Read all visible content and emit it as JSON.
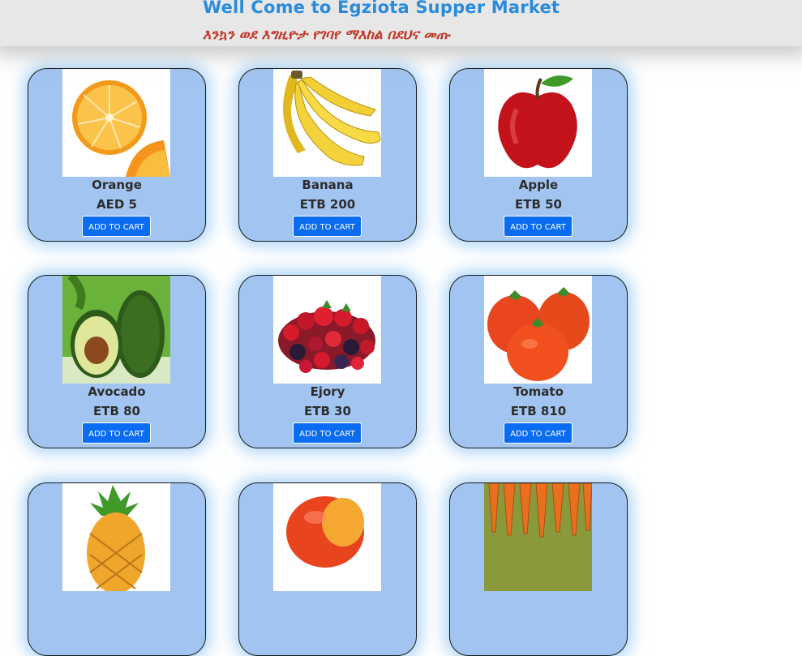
{
  "header": {
    "title": "Well Come to Egziota Supper Market",
    "subtitle": "እንኳን ወደ እግዚዮታ የገባየ ማእከል በደህና መጡ"
  },
  "products": [
    {
      "name": "Orange",
      "price": "AED 5",
      "button": "ADD TO CART",
      "icon": "orange-icon"
    },
    {
      "name": "Banana",
      "price": "ETB 200",
      "button": "ADD TO CART",
      "icon": "banana-icon"
    },
    {
      "name": "Apple",
      "price": "ETB 50",
      "button": "ADD TO CART",
      "icon": "apple-icon"
    },
    {
      "name": "Avocado",
      "price": "ETB 80",
      "button": "ADD TO CART",
      "icon": "avocado-icon"
    },
    {
      "name": "Ejory",
      "price": "ETB 30",
      "button": "ADD TO CART",
      "icon": "berries-icon"
    },
    {
      "name": "Tomato",
      "price": "ETB 810",
      "button": "ADD TO CART",
      "icon": "tomato-icon"
    },
    {
      "icon": "pineapple-icon"
    },
    {
      "icon": "mango-icon"
    },
    {
      "icon": "carrot-icon"
    }
  ],
  "colors": {
    "title": "#2a8bdc",
    "subtitle": "#c0392b",
    "card_bg": "#a2c4f0",
    "button_bg": "#0a6cf1"
  }
}
